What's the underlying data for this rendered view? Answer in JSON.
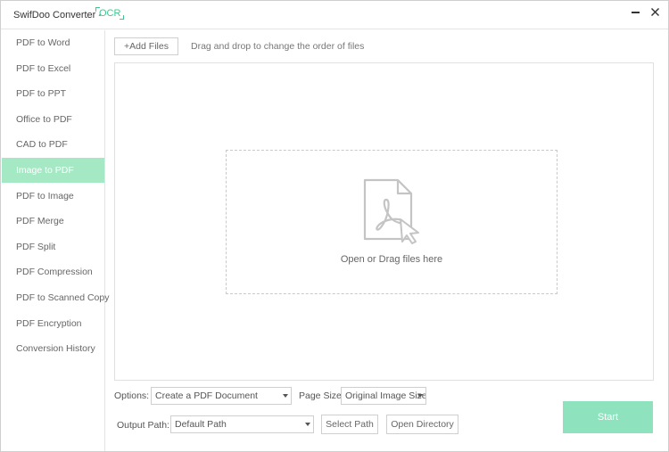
{
  "window": {
    "title": "SwifDoo Converter -",
    "ocr_label": "OCR",
    "close_symbol": "✕"
  },
  "sidebar": {
    "items": [
      {
        "label": "PDF to Word"
      },
      {
        "label": "PDF to Excel"
      },
      {
        "label": "PDF to PPT"
      },
      {
        "label": "Office to PDF"
      },
      {
        "label": "CAD to PDF"
      },
      {
        "label": "Image to PDF",
        "active": true
      },
      {
        "label": "PDF to Image"
      },
      {
        "label": "PDF Merge"
      },
      {
        "label": "PDF Split"
      },
      {
        "label": "PDF Compression"
      },
      {
        "label": "PDF to Scanned Copy"
      },
      {
        "label": "PDF Encryption"
      },
      {
        "label": "Conversion History"
      }
    ]
  },
  "toolbar": {
    "add_files_label": "+Add Files",
    "drag_hint": "Drag and drop to change the order of files"
  },
  "drop_zone": {
    "text": "Open or Drag files here",
    "icon": "pdf-file-icon"
  },
  "options": {
    "options_label": "Options:",
    "options_value": "Create a PDF Document",
    "page_size_label": "Page Size:",
    "page_size_value": "Original Image Size",
    "output_path_label": "Output Path:",
    "output_path_value": "Default Path",
    "select_path_label": "Select Path",
    "open_directory_label": "Open Directory",
    "start_label": "Start"
  },
  "colors": {
    "accent": "#3cc98f",
    "active_item": "#a4e8c4",
    "start_button": "#8ee2be"
  }
}
